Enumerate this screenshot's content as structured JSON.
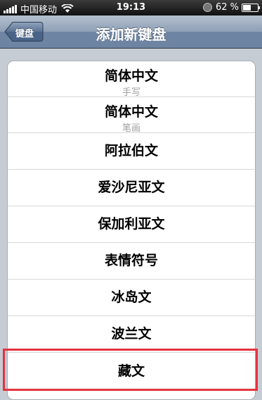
{
  "status_bar": {
    "carrier": "中国移动",
    "time": "19:13",
    "battery_percent": "62 %",
    "battery_level": 0.62
  },
  "navbar": {
    "back_label": "键盘",
    "title": "添加新键盘"
  },
  "keyboards": [
    {
      "label": "简体中文",
      "sub": "手写"
    },
    {
      "label": "简体中文",
      "sub": "笔画"
    },
    {
      "label": "阿拉伯文"
    },
    {
      "label": "爱沙尼亚文"
    },
    {
      "label": "保加利亚文"
    },
    {
      "label": "表情符号"
    },
    {
      "label": "冰岛文"
    },
    {
      "label": "波兰文"
    },
    {
      "label": "藏文"
    }
  ],
  "colors": {
    "highlight": "#e3343e",
    "nav_bar": "#6d84a2"
  }
}
